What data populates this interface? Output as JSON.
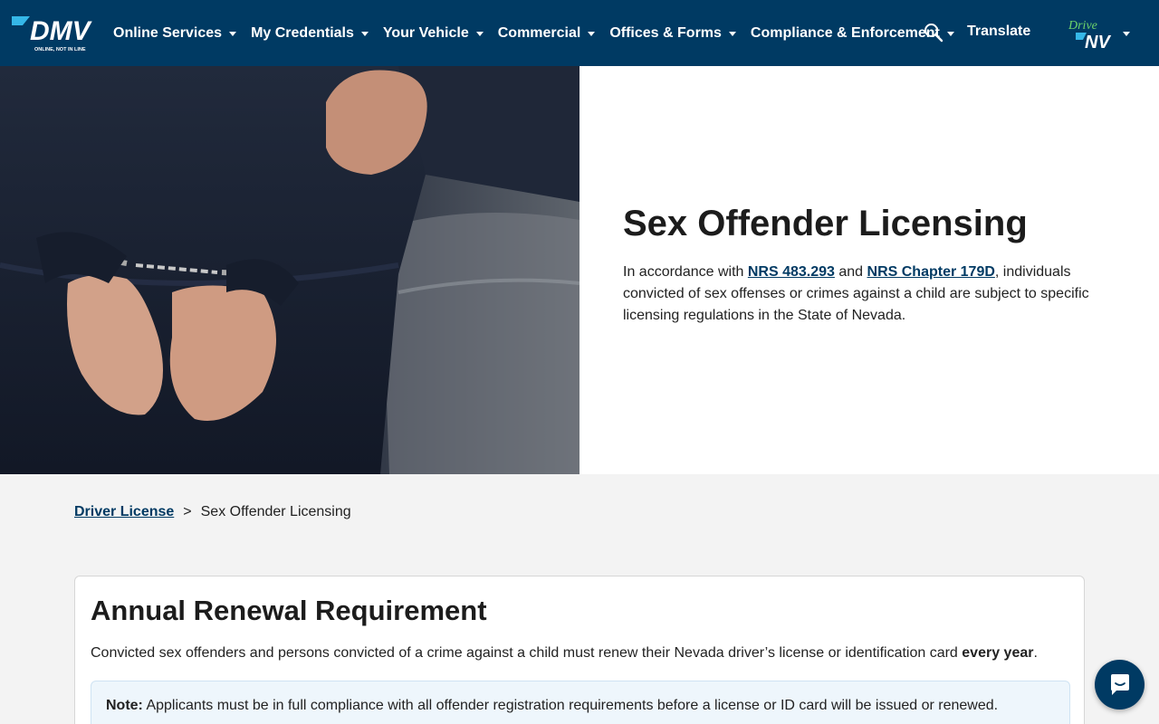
{
  "header": {
    "logo": {
      "text": "DMV",
      "tagline": "ONLINE, NOT IN LINE"
    },
    "nav": [
      {
        "label": "Online Services"
      },
      {
        "label": "My Credentials"
      },
      {
        "label": "Your Vehicle"
      },
      {
        "label": "Commercial"
      },
      {
        "label": "Offices & Forms"
      },
      {
        "label": "Compliance & Enforcement"
      }
    ],
    "translate_label": "Translate",
    "drivenv_logo": {
      "word1": "Drive",
      "word2": "NV"
    },
    "colors": {
      "bar": "#003a63",
      "text": "#ffffff"
    }
  },
  "hero": {
    "title": "Sex Offender Licensing",
    "desc_prefix": "In accordance with ",
    "link1": "NRS 483.293",
    "desc_mid": " and ",
    "link2": "NRS Chapter 179D",
    "desc_suffix": ", individuals convicted of sex offenses or crimes against a child are subject to specific licensing regulations in the State of Nevada."
  },
  "breadcrumb": {
    "parent": "Driver License",
    "separator": ">",
    "current": "Sex Offender Licensing"
  },
  "card": {
    "title": "Annual Renewal Requirement",
    "text_prefix": "Convicted sex offenders and persons convicted of a crime against a child must renew their Nevada driver’s license or identification card ",
    "text_bold": "every year",
    "text_suffix": ".",
    "note_label": "Note:",
    "note_text": " Applicants must be in full compliance with all offender registration requirements before a license or ID card will be issued or renewed."
  },
  "chat": {
    "icon": "chat-bubble-icon"
  }
}
